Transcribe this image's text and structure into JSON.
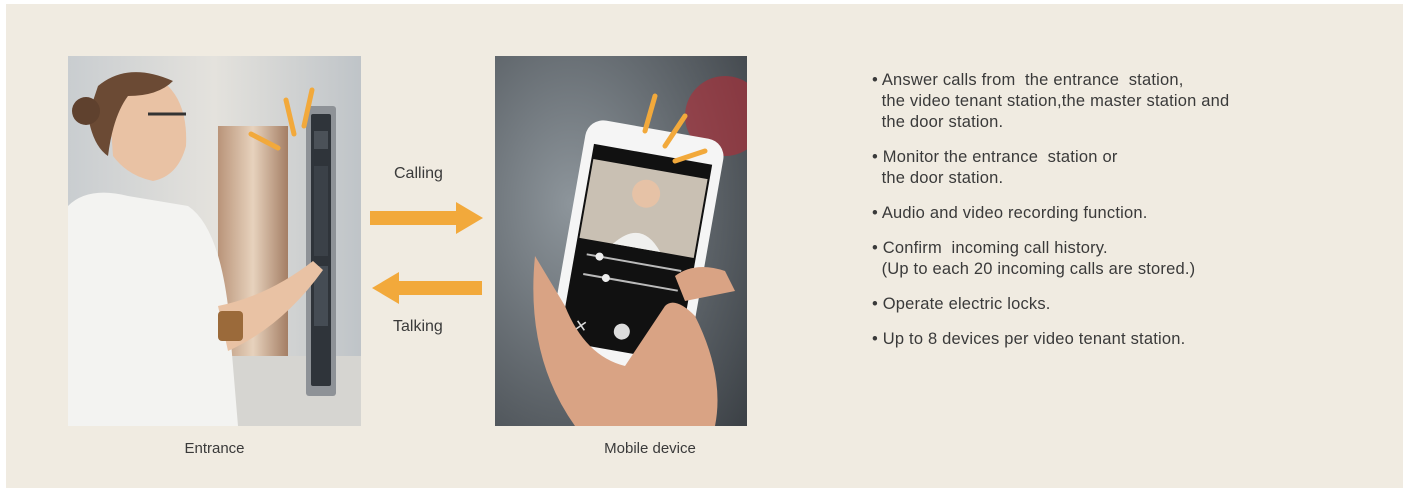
{
  "captions": {
    "entrance": "Entrance",
    "mobile": "Mobile device"
  },
  "flow": {
    "calling": "Calling",
    "talking": "Talking",
    "arrow_color": "#f2a93b"
  },
  "features": [
    {
      "lines": [
        "• Answer calls from  the entrance  station,",
        "  the video tenant station,the master station and",
        "  the door station."
      ]
    },
    {
      "lines": [
        "• Monitor the entrance  station or",
        "  the door station."
      ]
    },
    {
      "lines": [
        "• Audio and video recording function."
      ]
    },
    {
      "lines": [
        "• Confirm  incoming call history.",
        "  (Up to each 20 incoming calls are stored.)"
      ]
    },
    {
      "lines": [
        "• Operate electric locks."
      ]
    },
    {
      "lines": [
        "• Up to 8 devices per video tenant station."
      ]
    }
  ],
  "colors": {
    "panel_background": "#f0ebe1",
    "accent": "#f2a93b"
  }
}
